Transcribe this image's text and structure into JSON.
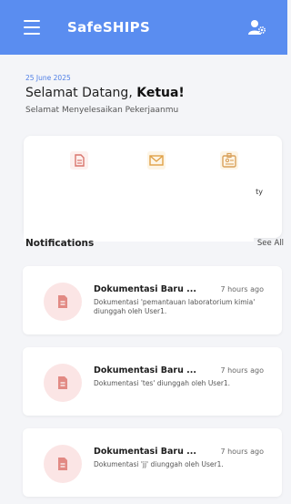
{
  "header": {
    "title": "SafeSHIPS",
    "background": "#5a8df0"
  },
  "welcome": {
    "date": "25 June 2025",
    "greeting_prefix": "Selamat Datang, ",
    "greeting_name": "Ketua!",
    "subtitle": "Selamat Menyelesaikan Pekerjaanmu"
  },
  "quick_actions": {
    "icons": [
      "document-icon",
      "mail-icon",
      "id-card-icon"
    ],
    "partial_label": "ty"
  },
  "notifications": {
    "section_title": "Notifications",
    "see_all_label": "See All",
    "items": [
      {
        "title": "Dokumentasi Baru ...",
        "time": "7 hours ago",
        "description": "Dokumentasi 'pemantauan laboratorium kimia' diunggah oleh User1."
      },
      {
        "title": "Dokumentasi Baru ...",
        "time": "7 hours ago",
        "description": "Dokumentasi 'tes' diunggah oleh User1."
      },
      {
        "title": "Dokumentasi Baru ...",
        "time": "7 hours ago",
        "description": "Dokumentasi 'jj' diunggah oleh User1."
      }
    ]
  }
}
